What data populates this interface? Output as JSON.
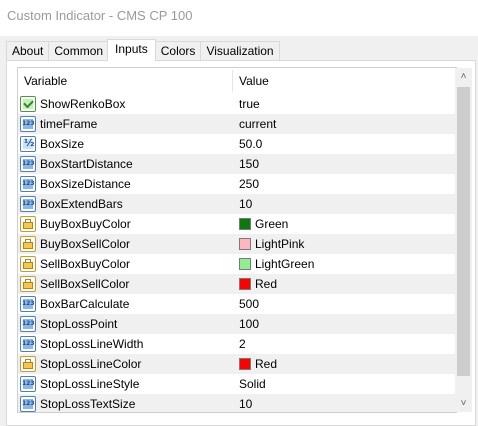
{
  "window": {
    "title": "Custom Indicator - CMS CP 100"
  },
  "tabs": [
    {
      "label": "About",
      "active": false
    },
    {
      "label": "Common",
      "active": false
    },
    {
      "label": "Inputs",
      "active": true
    },
    {
      "label": "Colors",
      "active": false
    },
    {
      "label": "Visualization",
      "active": false
    }
  ],
  "grid": {
    "columns": {
      "variable": "Variable",
      "value": "Value"
    },
    "rows": [
      {
        "icon": "bool-icon",
        "variable": "ShowRenkoBox",
        "value": "true"
      },
      {
        "icon": "integer-icon",
        "variable": "timeFrame",
        "value": "current"
      },
      {
        "icon": "double-icon",
        "variable": "BoxSize",
        "value": "50.0"
      },
      {
        "icon": "integer-icon",
        "variable": "BoxStartDistance",
        "value": "150"
      },
      {
        "icon": "integer-icon",
        "variable": "BoxSizeDistance",
        "value": "250"
      },
      {
        "icon": "integer-icon",
        "variable": "BoxExtendBars",
        "value": "10"
      },
      {
        "icon": "color-icon",
        "variable": "BuyBoxBuyColor",
        "value": "Green",
        "swatch": "#0a7a0a"
      },
      {
        "icon": "color-icon",
        "variable": "BuyBoxSellColor",
        "value": "LightPink",
        "swatch": "#ffb6c1"
      },
      {
        "icon": "color-icon",
        "variable": "SellBoxBuyColor",
        "value": "LightGreen",
        "swatch": "#90ee90"
      },
      {
        "icon": "color-icon",
        "variable": "SellBoxSellColor",
        "value": "Red",
        "swatch": "#ff0000"
      },
      {
        "icon": "integer-icon",
        "variable": "BoxBarCalculate",
        "value": "500"
      },
      {
        "icon": "integer-icon",
        "variable": "StopLossPoint",
        "value": "100"
      },
      {
        "icon": "integer-icon",
        "variable": "StopLossLineWidth",
        "value": "2"
      },
      {
        "icon": "color-icon",
        "variable": "StopLossLineColor",
        "value": "Red",
        "swatch": "#ff0000"
      },
      {
        "icon": "integer-icon",
        "variable": "StopLossLineStyle",
        "value": "Solid"
      },
      {
        "icon": "integer-icon",
        "variable": "StopLossTextSize",
        "value": "10"
      }
    ]
  },
  "scrollbar": {
    "up_arrow": "˄",
    "down_arrow": "˅"
  }
}
